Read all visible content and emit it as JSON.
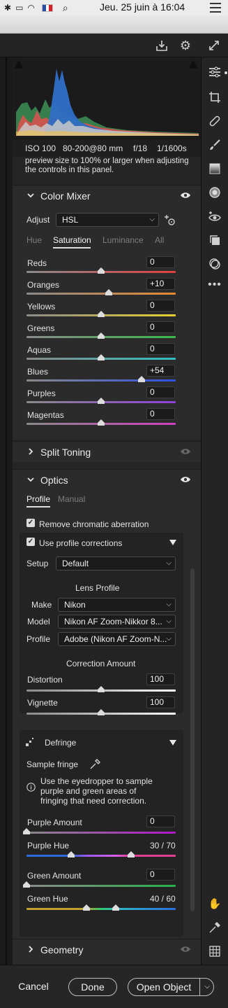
{
  "menubar": {
    "clock": "Jeu. 25 juin à  16:04"
  },
  "exif": {
    "iso": "ISO 100",
    "lens": "80-200@80 mm",
    "aperture": "f/18",
    "shutter": "1/1600s"
  },
  "notice_text": "preview size to 100% or larger when adjusting the controls in this panel.",
  "color_mixer": {
    "title": "Color Mixer",
    "adjust_label": "Adjust",
    "adjust_value": "HSL",
    "tabs": [
      "Hue",
      "Saturation",
      "Luminance",
      "All"
    ],
    "active_tab": "Saturation",
    "sliders": [
      {
        "label": "Reds",
        "value": "0",
        "level": 0.5
      },
      {
        "label": "Oranges",
        "value": "+10",
        "level": 0.55
      },
      {
        "label": "Yellows",
        "value": "0",
        "level": 0.5
      },
      {
        "label": "Greens",
        "value": "0",
        "level": 0.5
      },
      {
        "label": "Aquas",
        "value": "0",
        "level": 0.5
      },
      {
        "label": "Blues",
        "value": "+54",
        "level": 0.77
      },
      {
        "label": "Purples",
        "value": "0",
        "level": 0.5
      },
      {
        "label": "Magentas",
        "value": "0",
        "level": 0.5
      }
    ]
  },
  "split_toning": {
    "title": "Split Toning"
  },
  "optics": {
    "title": "Optics",
    "tabs": [
      "Profile",
      "Manual"
    ],
    "remove_ca": "Remove chromatic aberration",
    "use_profile": "Use profile corrections",
    "setup_label": "Setup",
    "setup_value": "Default",
    "lens_profile_heading": "Lens Profile",
    "make_label": "Make",
    "make_value": "Nikon",
    "model_label": "Model",
    "model_value": "Nikon AF Zoom-Nikkor 8...",
    "profile_label": "Profile",
    "profile_value": "Adobe (Nikon AF Zoom-N...",
    "correction_heading": "Correction Amount",
    "distortion_label": "Distortion",
    "distortion_value": "100",
    "distortion_level": 0.5,
    "vignette_label": "Vignette",
    "vignette_value": "100",
    "vignette_level": 0.5
  },
  "defringe": {
    "title": "Defringe",
    "sample_label": "Sample fringe",
    "info_text": "Use the eyedropper to sample purple and green areas of fringing that need correction.",
    "purple_amount_label": "Purple Amount",
    "purple_amount_value": "0",
    "purple_amount_level": 0,
    "purple_hue_label": "Purple Hue",
    "purple_hue_value": "30 / 70",
    "purple_hue_range": [
      0.3,
      0.7
    ],
    "green_amount_label": "Green Amount",
    "green_amount_value": "0",
    "green_amount_level": 0,
    "green_hue_label": "Green Hue",
    "green_hue_value": "40 / 60",
    "green_hue_range": [
      0.4,
      0.6
    ]
  },
  "geometry": {
    "title": "Geometry"
  },
  "buttons": {
    "cancel": "Cancel",
    "done": "Done",
    "open_object": "Open Object"
  }
}
